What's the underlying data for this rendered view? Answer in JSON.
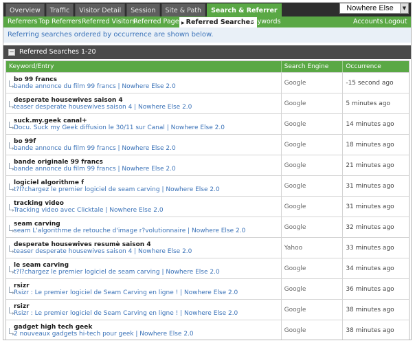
{
  "nav": {
    "tabs": [
      {
        "label": "Overview"
      },
      {
        "label": "Traffic"
      },
      {
        "label": "Visitor Detail"
      },
      {
        "label": "Session"
      },
      {
        "label": "Site & Path"
      },
      {
        "label": "Search & Referrer",
        "active": true
      }
    ],
    "site_selector": "Nowhere Else"
  },
  "subnav": {
    "items": [
      {
        "label": "Referrers"
      },
      {
        "label": "Top Referrers"
      },
      {
        "label": "Referred Visitors"
      },
      {
        "label": "Referred Pages"
      },
      {
        "label": "Referred Searches",
        "active": true
      },
      {
        "label": "Keywords"
      }
    ],
    "accounts": "Accounts",
    "logout": "Logout"
  },
  "info_text": "Referring searches ordered by occurrence are shown below.",
  "panel": {
    "title": "Referred Searches 1-20",
    "columns": [
      "Keyword/Entry",
      "Search Engine",
      "Occurrence"
    ],
    "rows": [
      {
        "keyword": "bo 99 francs",
        "entry": "bande annonce du film 99 francs | Nowhere Else 2.0",
        "engine": "Google",
        "occurrence": "-15 second ago"
      },
      {
        "keyword": "desperate housewives saison 4",
        "entry": "teaser desperate housewives saison 4 | Nowhere Else 2.0",
        "engine": "Google",
        "occurrence": "5 minutes ago"
      },
      {
        "keyword": "suck.my.geek canal+",
        "entry": "Docu. Suck my Geek diffusion le 30/11 sur Canal | Nowhere Else 2.0",
        "engine": "Google",
        "occurrence": "14 minutes ago"
      },
      {
        "keyword": "bo 99f",
        "entry": "bande annonce du film 99 francs | Nowhere Else 2.0",
        "engine": "Google",
        "occurrence": "18 minutes ago"
      },
      {
        "keyword": "bande originale 99 francs",
        "entry": "bande annonce du film 99 francs | Nowhere Else 2.0",
        "engine": "Google",
        "occurrence": "21 minutes ago"
      },
      {
        "keyword": "logiciel algorithme f",
        "entry": "t?l?chargez le premier logiciel de seam carving | Nowhere Else 2.0",
        "engine": "Google",
        "occurrence": "31 minutes ago"
      },
      {
        "keyword": "tracking video",
        "entry": "Tracking video avec Clicktale | Nowhere Else 2.0",
        "engine": "Google",
        "occurrence": "31 minutes ago"
      },
      {
        "keyword": "seam carving",
        "entry": "seam L'algorithme de retouche d'image r?volutionnaire | Nowhere Else 2.0",
        "engine": "Google",
        "occurrence": "32 minutes ago"
      },
      {
        "keyword": "desperate housewives resumè saison 4",
        "entry": "teaser desperate housewives saison 4 | Nowhere Else 2.0",
        "engine": "Yahoo",
        "occurrence": "33 minutes ago"
      },
      {
        "keyword": "le seam carving",
        "entry": "t?l?chargez le premier logiciel de seam carving | Nowhere Else 2.0",
        "engine": "Google",
        "occurrence": "34 minutes ago"
      },
      {
        "keyword": "rsizr",
        "entry": "Rsizr : Le premier logiciel de Seam Carving en ligne ! | Nowhere Else 2.0",
        "engine": "Google",
        "occurrence": "36 minutes ago"
      },
      {
        "keyword": "rsizr",
        "entry": "Rsizr : Le premier logiciel de Seam Carving en ligne ! | Nowhere Else 2.0",
        "engine": "Google",
        "occurrence": "38 minutes ago"
      },
      {
        "keyword": "gadget high tech geek",
        "entry": "2 nouveaux gadgets hi-tech pour geek | Nowhere Else 2.0",
        "engine": "Google",
        "occurrence": "38 minutes ago"
      }
    ]
  }
}
